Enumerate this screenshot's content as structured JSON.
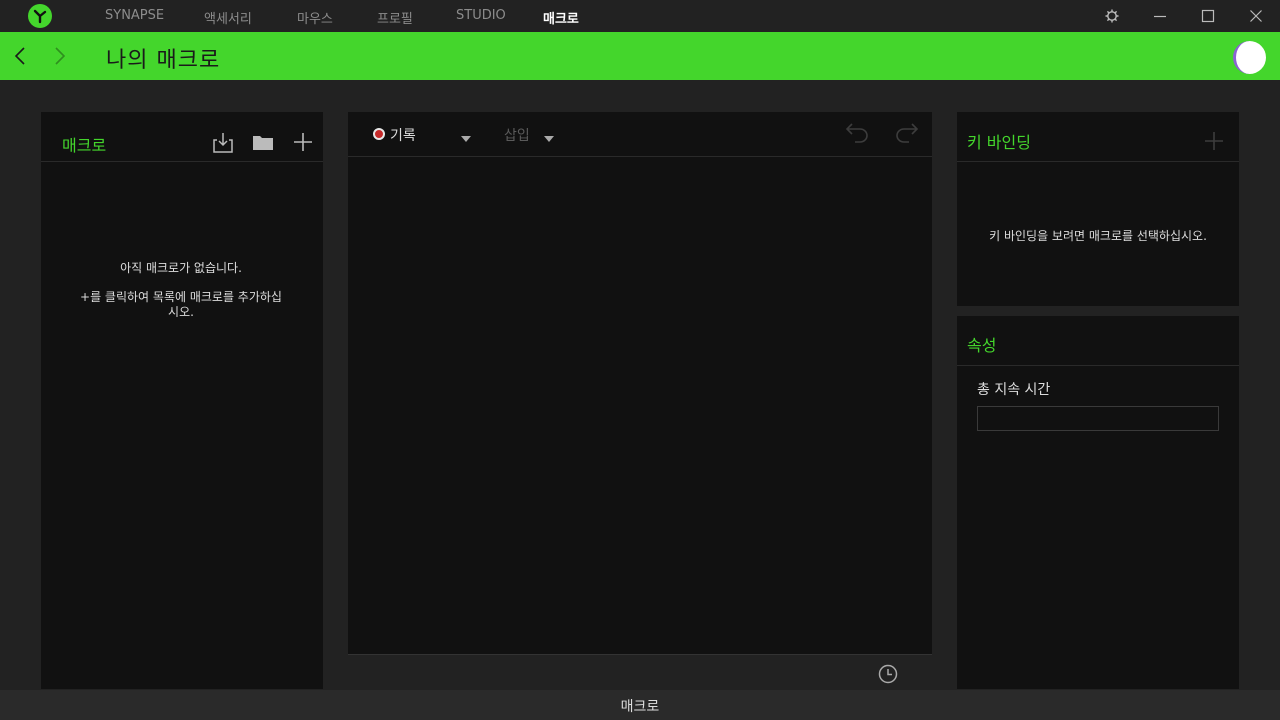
{
  "nav": {
    "tabs": [
      {
        "label": "SYNAPSE",
        "active": false
      },
      {
        "label": "액세서리",
        "active": false
      },
      {
        "label": "마우스",
        "active": false
      },
      {
        "label": "프로필",
        "active": false
      },
      {
        "label": "STUDIO",
        "active": false
      },
      {
        "label": "매크로",
        "active": true
      }
    ]
  },
  "header": {
    "title": "나의 매크로"
  },
  "macro_panel": {
    "title": "매크로",
    "empty_line1": "아직 매크로가 없습니다.",
    "empty_line2": "+를 클릭하여 목록에 매크로를 추가하십시오.",
    "icons": [
      "import-icon",
      "folder-icon",
      "plus-icon"
    ]
  },
  "editor": {
    "record_label": "기록",
    "insert_label": "삽입",
    "icons": [
      "undo-icon",
      "redo-icon",
      "clock-icon"
    ]
  },
  "keybinding_panel": {
    "title": "키 바인딩",
    "empty_text": "키 바인딩을 보려면 매크로를 선택하십시오."
  },
  "properties_panel": {
    "title": "속성",
    "total_duration_label": "총 지속 시간",
    "total_duration_value": ""
  },
  "status_bar": {
    "text": "매크로"
  },
  "colors": {
    "accent": "#44d62c",
    "background": "#222222",
    "panel": "#111111",
    "record": "#c62a2a"
  }
}
